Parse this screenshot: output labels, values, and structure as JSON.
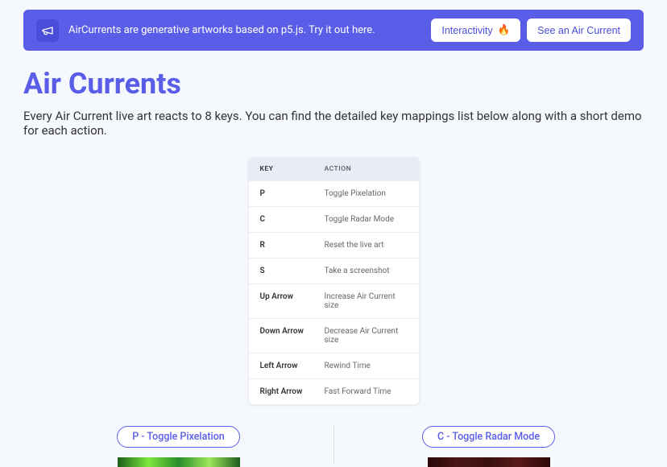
{
  "banner": {
    "text": "AirCurrents are generative artworks based on p5.js. Try it out here.",
    "interactivity_label": "Interactivity",
    "fire_icon": "🔥",
    "see_label": "See an Air Current"
  },
  "page": {
    "title": "Air Currents",
    "subtitle": "Every Air Current live art reacts to 8 keys. You can find the detailed key mappings list below along with a short demo for each action."
  },
  "table": {
    "header_key": "KEY",
    "header_action": "ACTION",
    "rows": [
      {
        "key": "P",
        "action": "Toggle Pixelation"
      },
      {
        "key": "C",
        "action": "Toggle Radar Mode"
      },
      {
        "key": "R",
        "action": "Reset the live art"
      },
      {
        "key": "S",
        "action": "Take a screenshot"
      },
      {
        "key": "Up Arrow",
        "action": "Increase Air Current size"
      },
      {
        "key": "Down Arrow",
        "action": "Decrease Air Current size"
      },
      {
        "key": "Left Arrow",
        "action": "Rewind Time"
      },
      {
        "key": "Right Arrow",
        "action": "Fast Forward Time"
      }
    ]
  },
  "demos": {
    "left_pill": "P - Toggle Pixelation",
    "right_pill": "C - Toggle Radar Mode"
  }
}
